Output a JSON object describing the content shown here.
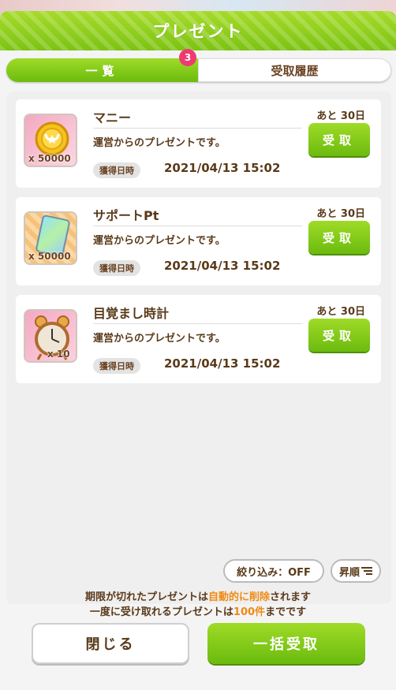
{
  "header": {
    "title": "プレゼント"
  },
  "tabs": [
    {
      "label": "一覧",
      "badge": "3",
      "active": true
    },
    {
      "label": "受取履歴",
      "active": false
    }
  ],
  "presents": [
    {
      "icon": "coin-icon",
      "count": "x 50000",
      "name": "マニー",
      "description": "運営からのプレゼントです。",
      "date_label": "獲得日時",
      "date": "2021/04/13 15:02",
      "remaining": "あと 30日",
      "button": "受取"
    },
    {
      "icon": "support-card-icon",
      "count": "x 50000",
      "name": "サポートPt",
      "description": "運営からのプレゼントです。",
      "date_label": "獲得日時",
      "date": "2021/04/13 15:02",
      "remaining": "あと 30日",
      "button": "受取"
    },
    {
      "icon": "alarm-clock-icon",
      "count": "x 10",
      "name": "目覚まし時計",
      "description": "運営からのプレゼントです。",
      "date_label": "獲得日時",
      "date": "2021/04/13 15:02",
      "remaining": "あと 30日",
      "button": "受取"
    }
  ],
  "filter": {
    "label": "絞り込み：OFF"
  },
  "sort": {
    "label": "昇順",
    "icon": "sort-lines-icon"
  },
  "notice": {
    "line1_a": "期限が切れたプレゼントは",
    "line1_b": "自動的に削除",
    "line1_c": "されます",
    "line2_a": "一度に受け取れるプレゼントは",
    "line2_b": "100件",
    "line2_c": "までです"
  },
  "buttons": {
    "close": "閉じる",
    "receive_all": "一括受取"
  },
  "colors": {
    "accent_green": "#7cc313",
    "brown_text": "#5a3a1a",
    "highlight_orange": "#ef8a14",
    "badge_pink": "#ee3a72"
  }
}
